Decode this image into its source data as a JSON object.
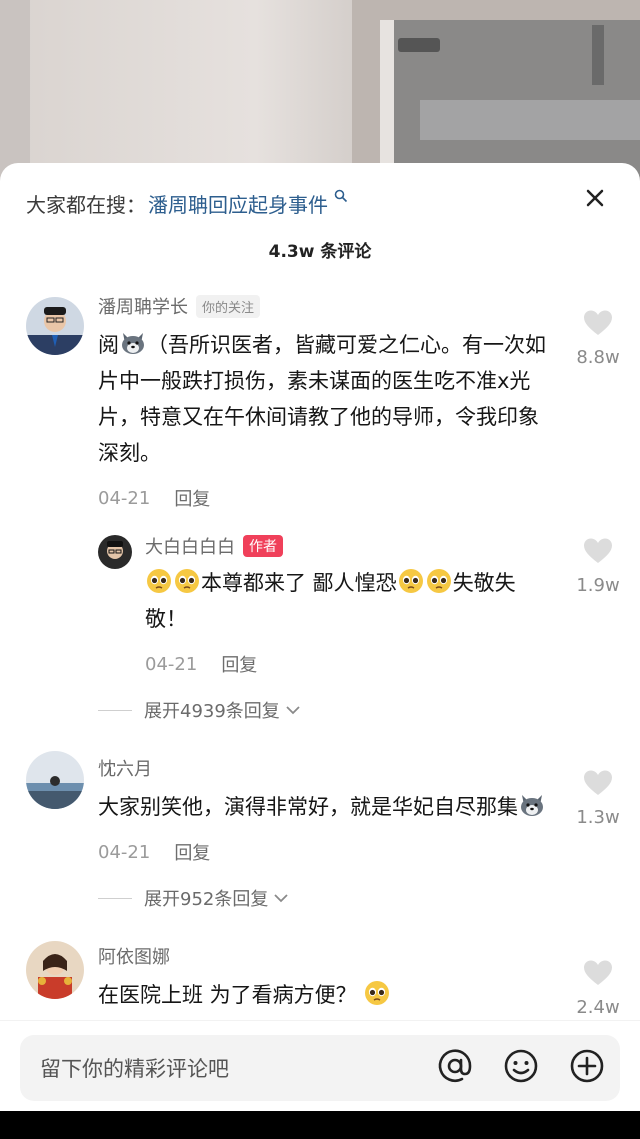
{
  "hot_search": {
    "prefix": "大家都在搜：",
    "link": "潘周聃回应起身事件",
    "link_icon": "search-icon"
  },
  "comment_count_title": "4.3w 条评论",
  "comments": [
    {
      "name": "潘周聃学长",
      "badge": "你的关注",
      "text": "阅🐺（吾所识医者，皆藏可爱之仁心。有一次如片中一般跌打损伤，素未谋面的医生吃不准x光片，特意又在午休间请教了他的导师，令我印象深刻。",
      "text_parts": [
        "阅",
        "（吾所识医者，皆藏可爱之仁心。有一次如片中一般跌打损伤，素未谋面的医生吃不准x光片，特意又在午休间请教了他的导师，令我印象深刻。"
      ],
      "date": "04-21",
      "reply_label": "回复",
      "likes": "8.8w",
      "sub_reply": {
        "name": "大白白白白",
        "badge": "作者",
        "text_parts": [
          "本尊都来了 鄙人惶恐",
          "失敬失敬！"
        ],
        "date": "04-21",
        "reply_label": "回复",
        "likes": "1.9w"
      },
      "expand_label": "展开4939条回复"
    },
    {
      "name": "忱六月",
      "text_parts": [
        "大家别笑他，演得非常好，就是华妃自尽那集"
      ],
      "date": "04-21",
      "reply_label": "回复",
      "likes": "1.3w",
      "expand_label": "展开952条回复"
    },
    {
      "name": "阿依图娜",
      "text_parts": [
        "在医院上班 为了看病方便？"
      ],
      "likes": "2.4w"
    }
  ],
  "input": {
    "placeholder": "留下你的精彩评论吧",
    "icons": [
      "at-icon",
      "emoji-icon",
      "plus-icon"
    ]
  },
  "colors": {
    "link": "#2d5e8e",
    "author_badge": "#f0405a",
    "meta_gray": "#9b9b9b"
  }
}
